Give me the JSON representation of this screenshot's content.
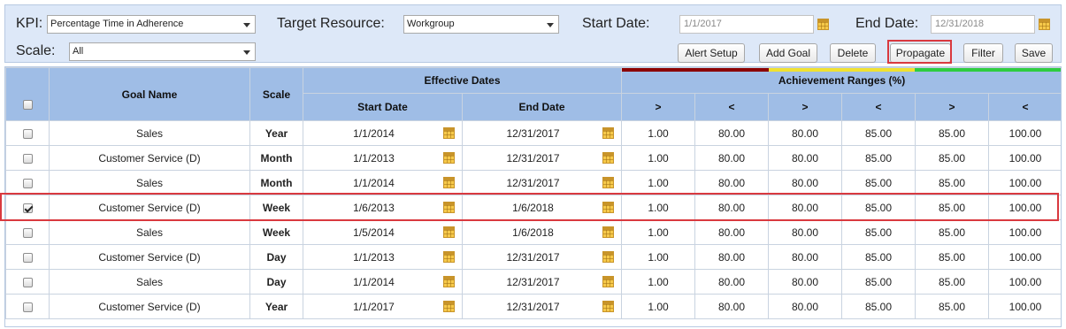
{
  "toolbar": {
    "kpi_label": "KPI:",
    "kpi_value": "Percentage Time in Adherence",
    "target_label": "Target Resource:",
    "target_value": "Workgroup",
    "start_label": "Start Date:",
    "start_value": "1/1/2017",
    "end_label": "End Date:",
    "end_value": "12/31/2018",
    "scale_label": "Scale:",
    "scale_value": "All",
    "buttons": {
      "alert_setup": "Alert Setup",
      "add_goal": "Add Goal",
      "delete": "Delete",
      "propagate": "Propagate",
      "filter": "Filter",
      "save": "Save"
    }
  },
  "grid": {
    "headers": {
      "goal_name": "Goal Name",
      "scale": "Scale",
      "effective_dates": "Effective Dates",
      "start_date": "Start Date",
      "end_date": "End Date",
      "achievement_ranges": "Achievement Ranges (%)",
      "gt": ">",
      "lt": "<"
    },
    "range_colors": {
      "red": "#8b0000",
      "yellow": "#f0e130",
      "green": "#2ecc40"
    },
    "rows": [
      {
        "checked": false,
        "name": "Sales",
        "scale": "Year",
        "start": "1/1/2014",
        "end": "12/31/2017",
        "r1": "1.00",
        "r2": "80.00",
        "r3": "80.00",
        "r4": "85.00",
        "r5": "85.00",
        "r6": "100.00"
      },
      {
        "checked": false,
        "name": "Customer Service (D)",
        "scale": "Month",
        "start": "1/1/2013",
        "end": "12/31/2017",
        "r1": "1.00",
        "r2": "80.00",
        "r3": "80.00",
        "r4": "85.00",
        "r5": "85.00",
        "r6": "100.00"
      },
      {
        "checked": false,
        "name": "Sales",
        "scale": "Month",
        "start": "1/1/2014",
        "end": "12/31/2017",
        "r1": "1.00",
        "r2": "80.00",
        "r3": "80.00",
        "r4": "85.00",
        "r5": "85.00",
        "r6": "100.00"
      },
      {
        "checked": true,
        "name": "Customer Service (D)",
        "scale": "Week",
        "start": "1/6/2013",
        "end": "1/6/2018",
        "r1": "1.00",
        "r2": "80.00",
        "r3": "80.00",
        "r4": "85.00",
        "r5": "85.00",
        "r6": "100.00"
      },
      {
        "checked": false,
        "name": "Sales",
        "scale": "Week",
        "start": "1/5/2014",
        "end": "1/6/2018",
        "r1": "1.00",
        "r2": "80.00",
        "r3": "80.00",
        "r4": "85.00",
        "r5": "85.00",
        "r6": "100.00"
      },
      {
        "checked": false,
        "name": "Customer Service (D)",
        "scale": "Day",
        "start": "1/1/2013",
        "end": "12/31/2017",
        "r1": "1.00",
        "r2": "80.00",
        "r3": "80.00",
        "r4": "85.00",
        "r5": "85.00",
        "r6": "100.00"
      },
      {
        "checked": false,
        "name": "Sales",
        "scale": "Day",
        "start": "1/1/2014",
        "end": "12/31/2017",
        "r1": "1.00",
        "r2": "80.00",
        "r3": "80.00",
        "r4": "85.00",
        "r5": "85.00",
        "r6": "100.00"
      },
      {
        "checked": false,
        "name": "Customer Service (D)",
        "scale": "Year",
        "start": "1/1/2017",
        "end": "12/31/2017",
        "r1": "1.00",
        "r2": "80.00",
        "r3": "80.00",
        "r4": "85.00",
        "r5": "85.00",
        "r6": "100.00"
      }
    ]
  }
}
